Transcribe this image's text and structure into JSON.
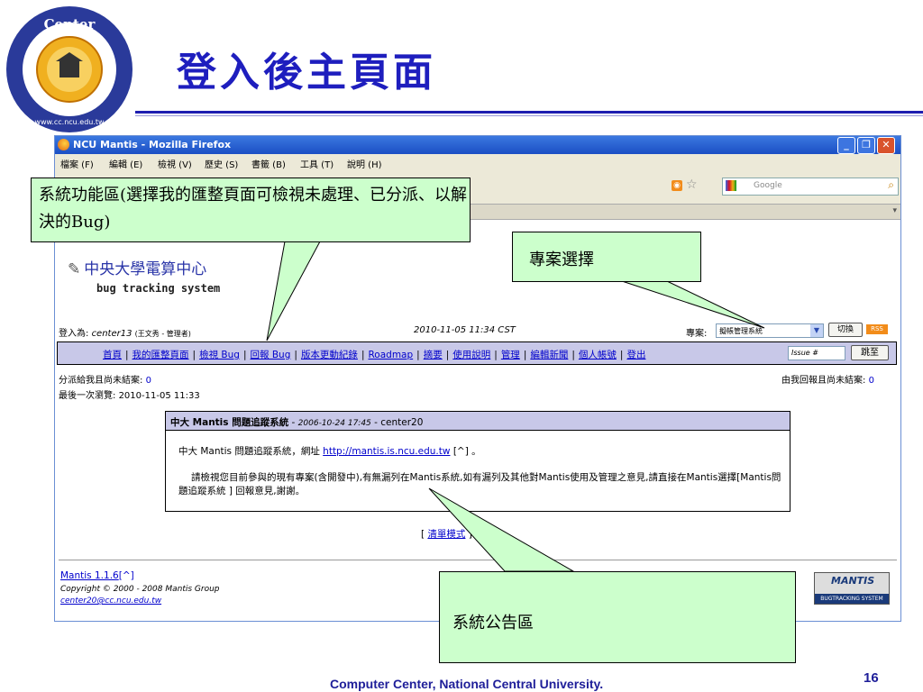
{
  "slide": {
    "title": "登入後主頁面",
    "footer": "Computer Center, National Central University.",
    "page_number": "16",
    "logo_text": "Computer Center",
    "logo_url": "www.cc.ncu.edu.tw"
  },
  "browser": {
    "window_title": "NCU Mantis - Mozilla Firefox",
    "menu": [
      "檔案 (F)",
      "編輯 (E)",
      "檢視 (V)",
      "歷史 (S)",
      "書籤 (B)",
      "工具 (T)",
      "說明 (H)"
    ],
    "search_placeholder": "Google",
    "win_buttons": {
      "minimize": "_",
      "restore": "❐",
      "close": "✕"
    }
  },
  "page": {
    "site_title": "中央大學電算中心",
    "site_subtitle": "bug tracking system",
    "login_label": "登入為:",
    "login_user": "center13",
    "login_name": "(王文秀 - 管理者)",
    "date": "2010-11-05 11:34 CST",
    "project_label": "專案:",
    "project_value": "擬帳管理系統",
    "switch_button": "切換",
    "rss_badge": "RSS",
    "nav": [
      "首頁",
      "我的匯整頁面",
      "檢視 Bug",
      "回報 Bug",
      "版本更動紀錄",
      "Roadmap",
      "摘要",
      "使用說明",
      "管理",
      "編輯新聞",
      "個人帳號",
      "登出"
    ],
    "issue_placeholder": "Issue #",
    "jump_button": "跳至",
    "assigned_label": "分派給我且尚未結案:",
    "assigned_count": "0",
    "reported_label": "由我回報且尚未結案:",
    "reported_count": "0",
    "last_visit_label": "最後一次瀏覽:",
    "last_visit": "2010-11-05 11:33",
    "news": {
      "title": "中大 Mantis 問題追蹤系統",
      "date": "2006-10-24 17:45",
      "author": "center20",
      "line1_text": "中大 Mantis 問題追蹤系統，網址",
      "line1_link": "http://mantis.is.ncu.edu.tw",
      "line1_suffix": "[^] 。",
      "body": "請檢視您目前參與的現有專案(含開發中),有無漏列在Mantis系統,如有漏列及其他對Mantis使用及管理之意見,請直接在Mantis選擇[Mantis問題追蹤系統 ] 回報意見,謝謝。"
    },
    "list_mode": "清單模式",
    "version": "Mantis 1.1.6",
    "version_suffix": "[^]",
    "copyright": "Copyright © 2000 - 2008 Mantis Group",
    "email": "center20@cc.ncu.edu.tw",
    "mantis_logo": "MANTIS",
    "mantis_logo_sub": "BUGTRACKING SYSTEM"
  },
  "callouts": {
    "function_area": "系統功能區(選擇我的匯整頁面可檢視未處理、已分派、以解決的Bug)",
    "project_select": "專案選擇",
    "news_area": "系統公告區"
  }
}
